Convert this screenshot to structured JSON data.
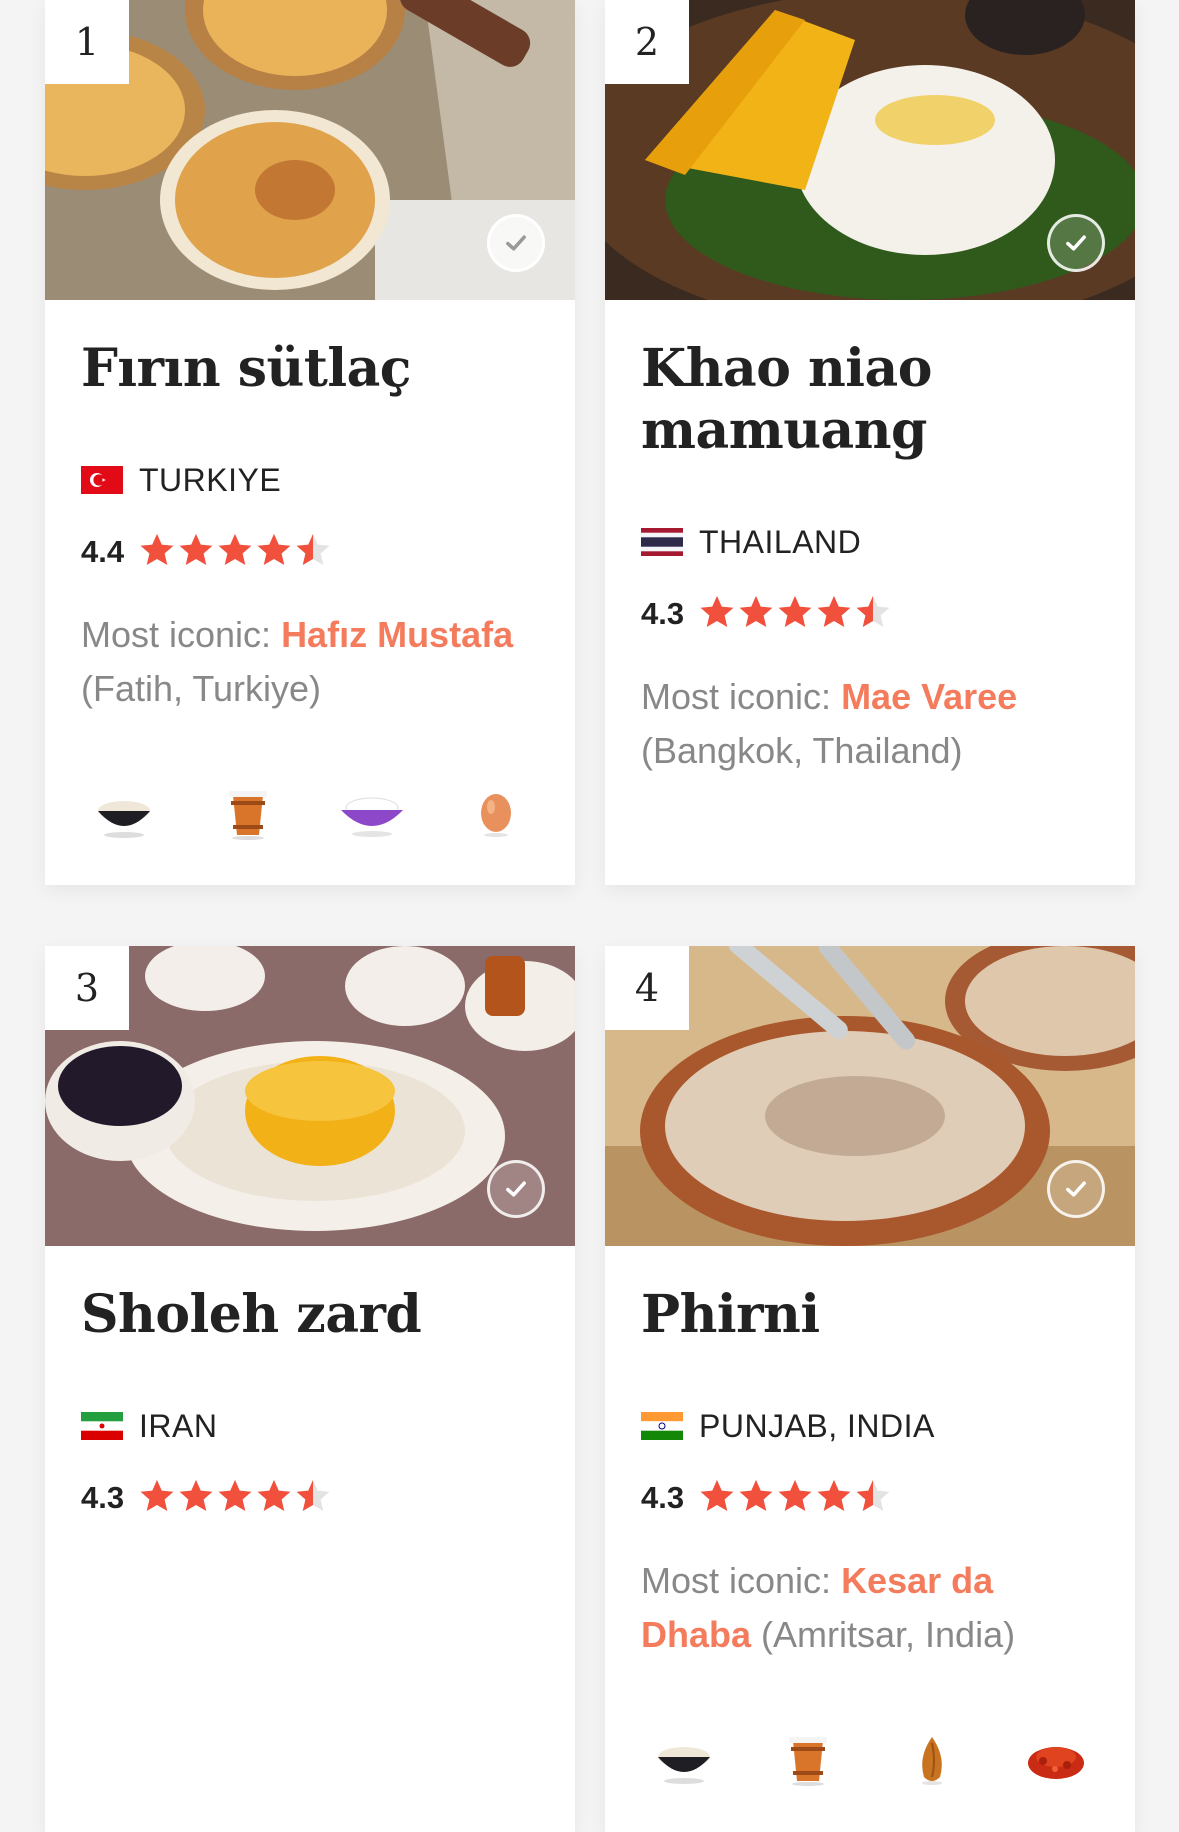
{
  "cards": [
    {
      "rank": "1",
      "title": "Fırın sütlaç",
      "country": "TURKIYE",
      "flag": "turkey-flag",
      "rating": "4.4",
      "stars": 4.5,
      "iconic_prefix": "Most iconic: ",
      "iconic_place": "Hafız Mustafa",
      "iconic_location": " (Fatih, Turkiye)",
      "ingredients": [
        "rice-bowl-icon",
        "wooden-bucket-icon",
        "cream-bowl-icon",
        "egg-icon"
      ]
    },
    {
      "rank": "2",
      "title": "Khao niao mamuang",
      "country": "THAILAND",
      "flag": "thailand-flag",
      "rating": "4.3",
      "stars": 4.5,
      "iconic_prefix": "Most iconic: ",
      "iconic_place": "Mae Varee",
      "iconic_location": " (Bangkok, Thailand)",
      "ingredients": []
    },
    {
      "rank": "3",
      "title": "Sholeh zard",
      "country": "IRAN",
      "flag": "iran-flag",
      "rating": "4.3",
      "stars": 4.5,
      "iconic_prefix": "",
      "iconic_place": "",
      "iconic_location": "",
      "ingredients": []
    },
    {
      "rank": "4",
      "title": "Phirni",
      "country": "PUNJAB, INDIA",
      "flag": "india-flag",
      "rating": "4.3",
      "stars": 4.5,
      "iconic_prefix": "Most iconic: ",
      "iconic_place": "Kesar da Dhaba",
      "iconic_location": " (Amritsar, India)",
      "ingredients": [
        "rice-bowl-icon",
        "wooden-bucket-icon",
        "almond-icon",
        "saffron-icon"
      ]
    }
  ],
  "colors": {
    "accent": "#f47b5c",
    "star": "#f0503c",
    "star_empty": "#e3e3e3",
    "text": "#222222",
    "muted": "#888888"
  }
}
